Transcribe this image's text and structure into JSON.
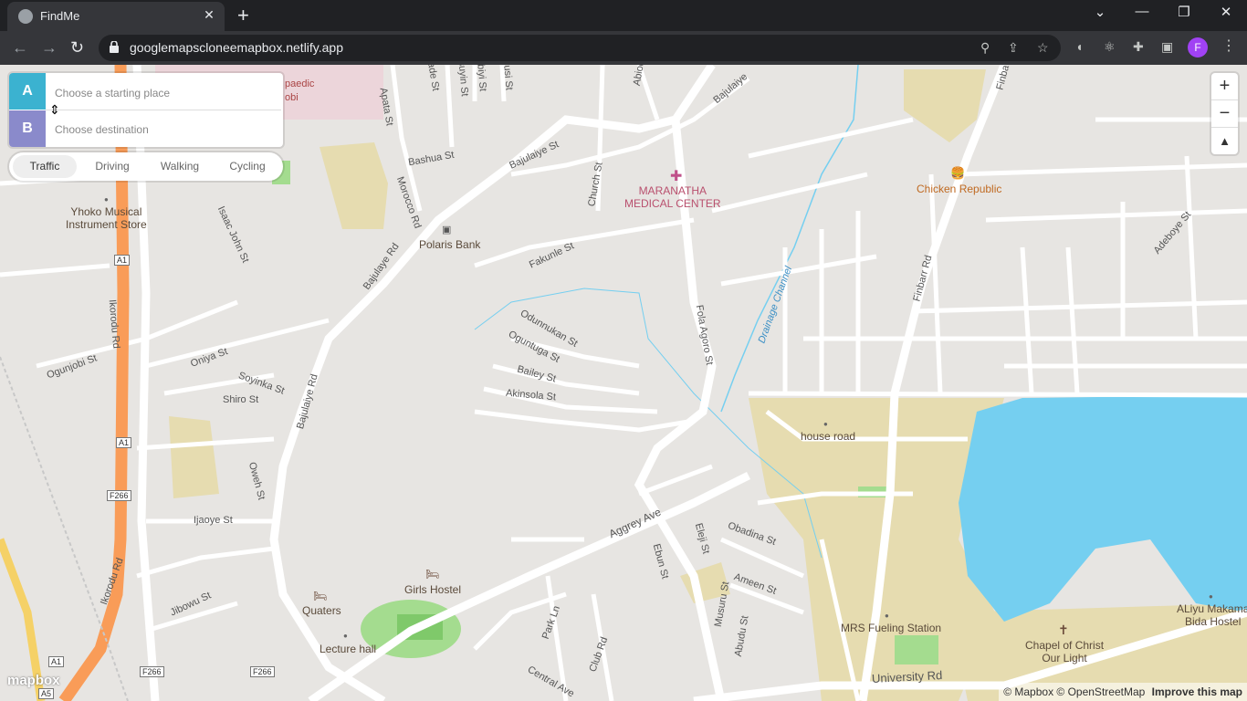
{
  "browser": {
    "tab_title": "FindMe",
    "url": "googlemapscloneemapbox.netlify.app",
    "profile_initial": "F",
    "new_tab": "+",
    "close": "✕",
    "back": "←",
    "forward": "→",
    "reload": "↻",
    "minimize": "—",
    "restore": "❐",
    "win_close": "✕",
    "tab_list": "⌄",
    "menu": "⋮"
  },
  "directions": {
    "origin_label": "A",
    "origin_placeholder": "Choose a starting place",
    "dest_label": "B",
    "dest_placeholder": "Choose destination",
    "reverse_glyph": "⇕"
  },
  "profiles": [
    "Traffic",
    "Driving",
    "Walking",
    "Cycling"
  ],
  "active_profile": "Traffic",
  "zoom": {
    "in": "+",
    "out": "−",
    "compass": "▲"
  },
  "map": {
    "colors": {
      "land": "#e7e5e2",
      "road": "#ffffff",
      "highway": "#f99c58",
      "water": "#75cff0",
      "park": "#a4dc8f",
      "sand": "#e6dcb0"
    },
    "labels": {
      "aladest": "Alade St",
      "apatast": "Apata St",
      "bashuast": "Bashua St",
      "morocco": "Morocco Rd",
      "bajulaiyest": "Bajulaiye St",
      "bajulaiye2": "Bajulaiye",
      "churchst": "Church St",
      "fakunle": "Fakunle St",
      "bajulaye": "Bajulaye Rd",
      "bajulaiyerd": "Bajulaiye Rd",
      "folaagoro": "Fola Agoro St",
      "drainage": "Drainage Channel",
      "finbarr": "Finbarr Rd",
      "adeboye": "Adeboye St",
      "odunnukan": "Odunnukan St",
      "oguntuga": "Oguntuga St",
      "bailey": "Bailey St",
      "akinsola": "Akinsola St",
      "isaacjohn": "Isaac John St",
      "ikorodu": "Ikorodu Rd",
      "ikorodu2": "Ikorodu Rd",
      "ogunjobi": "Ogunjobi St",
      "oniya": "Oniya St",
      "soyinka": "Soyinka St",
      "shiro": "Shiro St",
      "oweh": "Oweh St",
      "ijaoye": "Ijaoye St",
      "jibowu": "Jibowu St",
      "aggrey": "Aggrey Ave",
      "ebun": "Ebun St",
      "eleji": "Eleji St",
      "obadina": "Obadina St",
      "ameen": "Ameen St",
      "musuru": "Musuru St",
      "abudu": "Abudu St",
      "parkln": "Park Ln",
      "clubrd": "Club Rd",
      "central": "Central Ave",
      "university": "University Rd",
      "a1a": "A1",
      "a1b": "A1",
      "a1c": "A1",
      "a5": "A5",
      "f266a": "F266",
      "f266b": "F266",
      "f266c": "F266",
      "finba": "Finba",
      "abiod": "Abiod",
      "wosuyin": "wosuyin St",
      "adebiyi": "debiyi St",
      "anusi": "anusi St",
      "paedic": "paedic",
      "obi": "obi"
    },
    "pois": {
      "maranatha": "MARANATHA\nMEDICAL CENTER",
      "chicken": "Chicken Republic",
      "polaris": "Polaris Bank",
      "yhoko": "Yhoko Musical\nInstrument Store",
      "house": "house road",
      "girlshostel": "Girls Hostel",
      "quaters": "Quaters",
      "lecture": "Lecture hall",
      "mrs": "MRS Fueling Station",
      "chapel": "Chapel of Christ\nOur Light",
      "aliyu": "ALiyu Makama\nBida Hostel"
    },
    "attribution": "© Mapbox © OpenStreetMap",
    "improve": "Improve this map",
    "logo": "mapbox"
  }
}
